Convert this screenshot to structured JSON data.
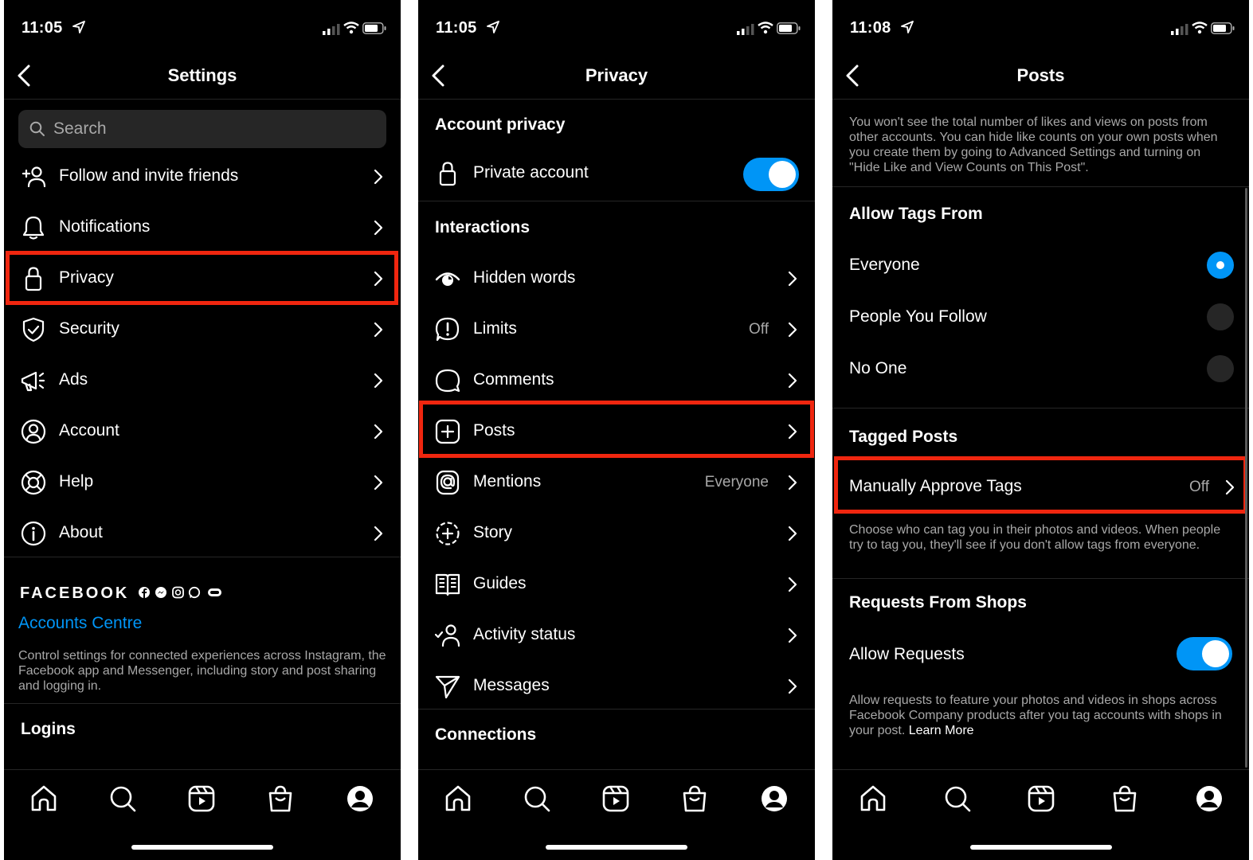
{
  "screens": [
    {
      "status_time": "11:05",
      "title": "Settings",
      "search_placeholder": "Search",
      "items": [
        {
          "label": "Follow and invite friends",
          "icon": "add-person-icon"
        },
        {
          "label": "Notifications",
          "icon": "bell-icon"
        },
        {
          "label": "Privacy",
          "icon": "lock-icon"
        },
        {
          "label": "Security",
          "icon": "shield-icon"
        },
        {
          "label": "Ads",
          "icon": "megaphone-icon"
        },
        {
          "label": "Account",
          "icon": "account-circle-icon"
        },
        {
          "label": "Help",
          "icon": "lifebuoy-icon"
        },
        {
          "label": "About",
          "icon": "info-icon"
        }
      ],
      "facebook_wordmark": "FACEBOOK",
      "accounts_centre_link": "Accounts Centre",
      "accounts_centre_description": "Control settings for connected experiences across Instagram, the Facebook app and Messenger, including story and post sharing and logging in.",
      "logins_heading": "Logins",
      "highlighted_item": "Privacy"
    },
    {
      "status_time": "11:05",
      "title": "Privacy",
      "account_privacy_heading": "Account privacy",
      "private_account_label": "Private account",
      "private_account_enabled": true,
      "interactions_heading": "Interactions",
      "items": [
        {
          "label": "Hidden words",
          "value": "",
          "icon": "eye-icon"
        },
        {
          "label": "Limits",
          "value": "Off",
          "icon": "alert-bubble-icon"
        },
        {
          "label": "Comments",
          "value": "",
          "icon": "comment-icon"
        },
        {
          "label": "Posts",
          "value": "",
          "icon": "plus-square-icon"
        },
        {
          "label": "Mentions",
          "value": "Everyone",
          "icon": "at-sign-icon"
        },
        {
          "label": "Story",
          "value": "",
          "icon": "story-plus-icon"
        },
        {
          "label": "Guides",
          "value": "",
          "icon": "guides-book-icon"
        },
        {
          "label": "Activity status",
          "value": "",
          "icon": "activity-person-icon"
        },
        {
          "label": "Messages",
          "value": "",
          "icon": "paper-plane-icon"
        }
      ],
      "connections_heading": "Connections",
      "highlighted_item": "Posts"
    },
    {
      "status_time": "11:08",
      "title": "Posts",
      "intro": "You won't see the total number of likes and views on posts from other accounts. You can hide like counts on your own posts when you create them by going to Advanced Settings and turning on \"Hide Like and View Counts on This Post\".",
      "allow_tags_heading": "Allow Tags From",
      "tag_options": [
        {
          "label": "Everyone",
          "selected": true
        },
        {
          "label": "People You Follow",
          "selected": false
        },
        {
          "label": "No One",
          "selected": false
        }
      ],
      "tagged_posts_heading": "Tagged Posts",
      "manually_approve_label": "Manually Approve Tags",
      "manually_approve_value": "Off",
      "tagged_posts_description": "Choose who can tag you in their photos and videos. When people try to tag you, they'll see if you don't allow tags from everyone.",
      "requests_heading": "Requests From Shops",
      "allow_requests_label": "Allow Requests",
      "allow_requests_enabled": true,
      "requests_description": "Allow requests to feature your photos and videos in shops across Facebook Company products after you tag accounts with shops in your post.",
      "learn_more": "Learn More",
      "highlighted_item": "Manually Approve Tags"
    }
  ],
  "tabbar": [
    "home-icon",
    "search-icon",
    "reels-icon",
    "shop-icon",
    "profile-icon"
  ],
  "colors": {
    "highlight": "#f0260f",
    "accent": "#0095f6",
    "background": "#000000",
    "secondary_text": "#a8a8a8"
  }
}
